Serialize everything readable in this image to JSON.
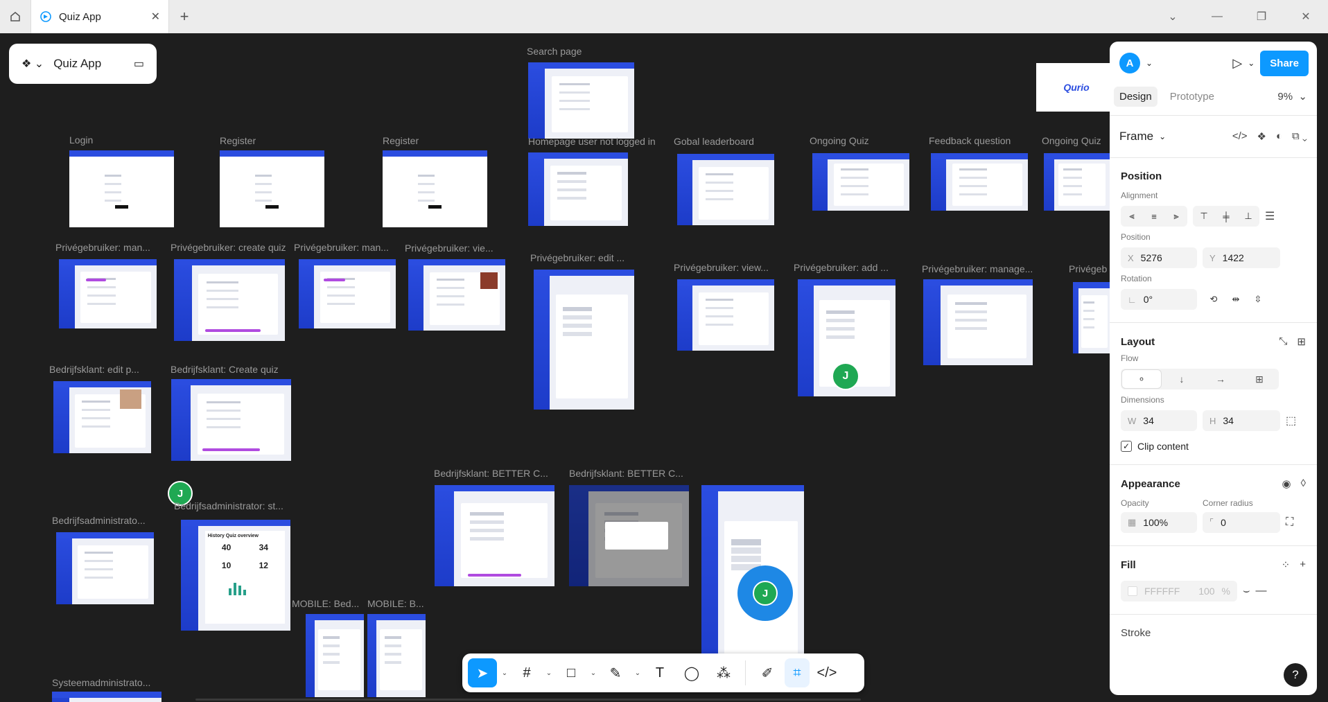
{
  "tab": {
    "title": "Quiz App"
  },
  "file": {
    "name": "Quiz App"
  },
  "brand": {
    "logo": "Qurio"
  },
  "labels": {
    "search": "Search page",
    "login": "Login",
    "register1": "Register",
    "register2": "Register",
    "homepage": "Homepage user not logged in",
    "gobal": "Gobal leaderboard",
    "ongoing1": "Ongoing Quiz",
    "feedback": "Feedback question",
    "ongoing2": "Ongoing Quiz",
    "pg_man1": "Privégebruiker: man...",
    "pg_create": "Privégebruiker: create quiz",
    "pg_man2": "Privégebruiker: man...",
    "pg_vie": "Privégebruiker: vie...",
    "pg_edit": "Privégebruiker: edit ...",
    "pg_view": "Privégebruiker: view...",
    "pg_add": "Privégebruiker: add ...",
    "pg_manage": "Privégebruiker: manage...",
    "pg_cut": "Privégeb",
    "bk_edit": "Bedrijfsklant: edit p...",
    "bk_create": "Bedrijfsklant: Create quiz",
    "bk_better1": "Bedrijfsklant: BETTER C...",
    "bk_better2": "Bedrijfsklant: BETTER C...",
    "ba_1": "Bedrijfsadministrato...",
    "ba_st": "Bedrijfsadministrator: st...",
    "mobile1": "MOBILE: Bed...",
    "mobile2": "MOBILE: B...",
    "sys": "Systeemadministrato..."
  },
  "stats": {
    "a": "40",
    "b": "34",
    "c": "10",
    "d": "12",
    "title": "History Quiz overview"
  },
  "avatars": {
    "j": "J"
  },
  "panel": {
    "user_initial": "A",
    "share": "Share",
    "tabs": {
      "design": "Design",
      "prototype": "Prototype"
    },
    "zoom": "9%",
    "frame_title": "Frame",
    "position": {
      "title": "Position",
      "alignment": "Alignment",
      "position_label": "Position",
      "x_label": "X",
      "x": "5276",
      "y_label": "Y",
      "y": "1422",
      "rotation_label": "Rotation",
      "rotation": "0°"
    },
    "layout": {
      "title": "Layout",
      "flow": "Flow",
      "dimensions": "Dimensions",
      "w_label": "W",
      "w": "34",
      "h_label": "H",
      "h": "34",
      "clip": "Clip content"
    },
    "appearance": {
      "title": "Appearance",
      "opacity_label": "Opacity",
      "opacity": "100%",
      "radius_label": "Corner radius",
      "radius": "0"
    },
    "fill": {
      "title": "Fill",
      "hex": "FFFFFF",
      "pct": "100",
      "unit": "%"
    },
    "stroke": {
      "title": "Stroke"
    },
    "help": "?"
  },
  "colors": {
    "accent": "#0d99ff",
    "brand_blue": "#2b4de0",
    "avatar_green": "#1fa853",
    "canvas": "#1e1e1e"
  }
}
